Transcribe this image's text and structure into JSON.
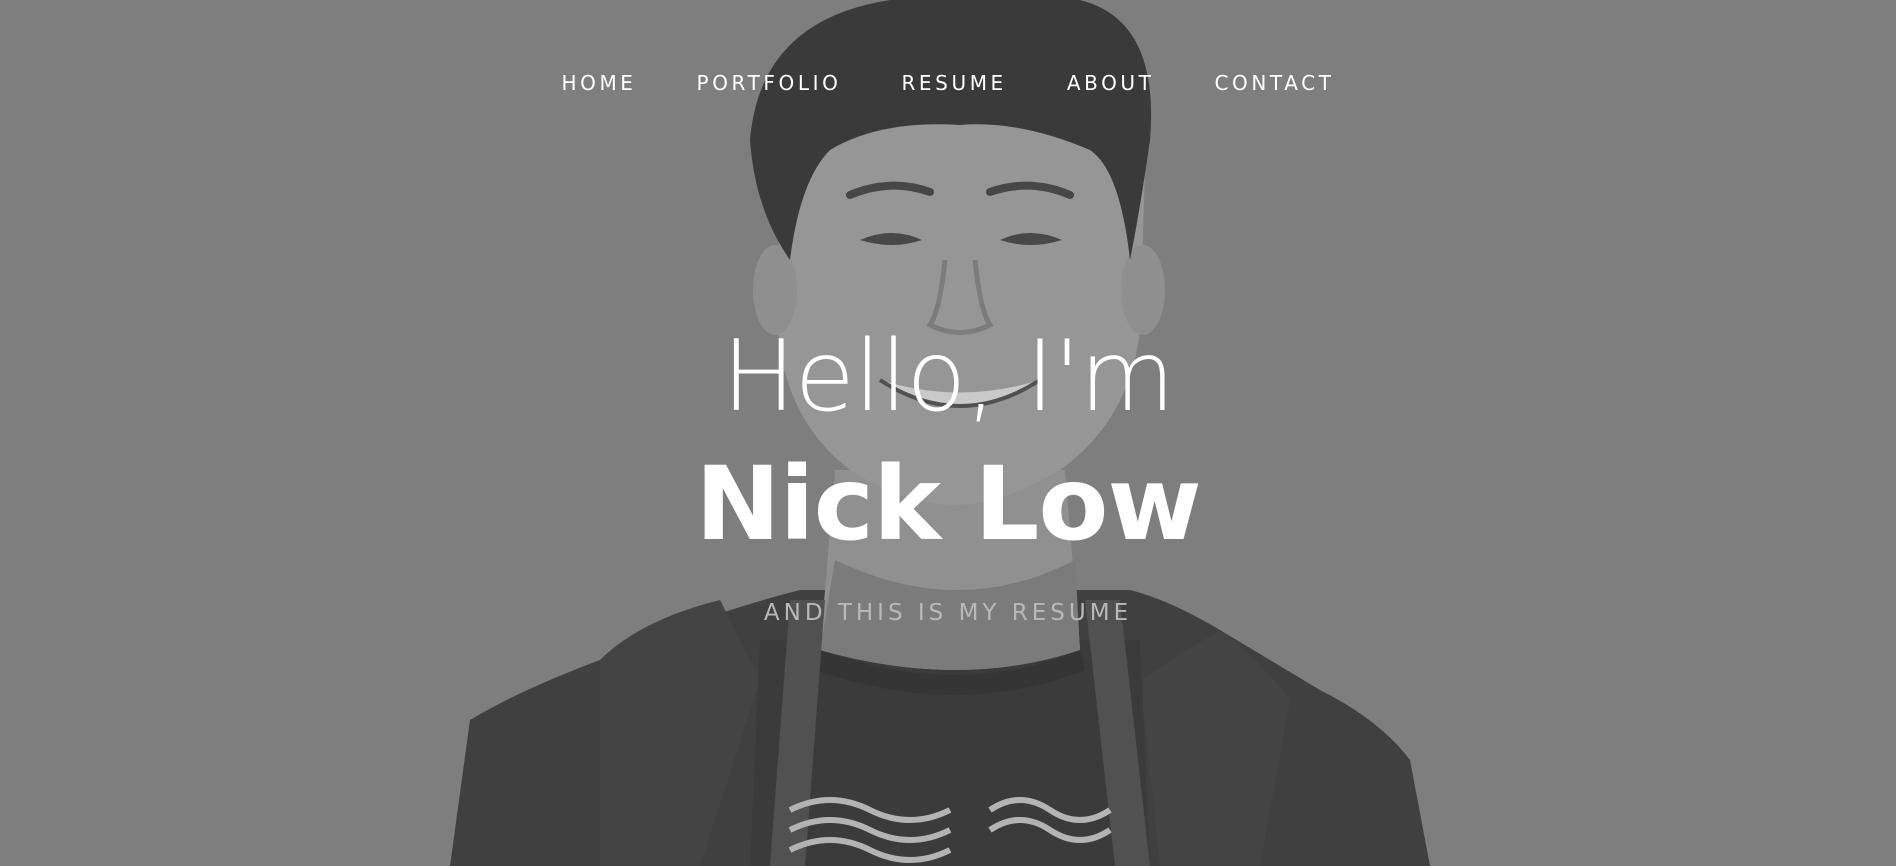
{
  "nav": {
    "items": [
      {
        "label": "HOME"
      },
      {
        "label": "PORTFOLIO"
      },
      {
        "label": "RESUME"
      },
      {
        "label": "ABOUT"
      },
      {
        "label": "CONTACT"
      }
    ]
  },
  "hero": {
    "greeting": "Hello, I'm",
    "name": "Nick Low",
    "tagline": "AND THIS IS MY RESUME",
    "background_color": "#7f7f7f",
    "photo": "grayscale-portrait-photo"
  }
}
